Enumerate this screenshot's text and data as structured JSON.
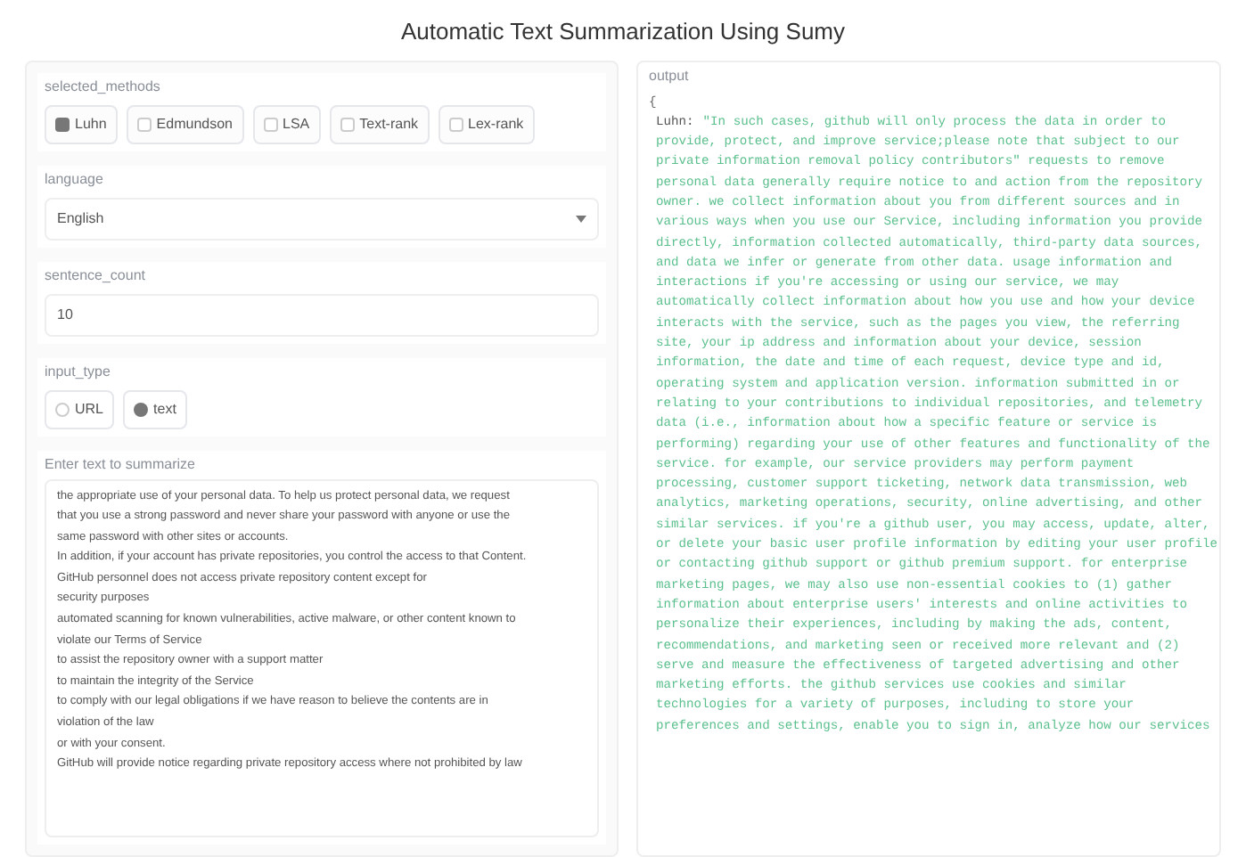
{
  "title": "Automatic Text Summarization Using Sumy",
  "methods": {
    "label": "selected_methods",
    "options": [
      {
        "label": "Luhn",
        "checked": true
      },
      {
        "label": "Edmundson",
        "checked": false
      },
      {
        "label": "LSA",
        "checked": false
      },
      {
        "label": "Text-rank",
        "checked": false
      },
      {
        "label": "Lex-rank",
        "checked": false
      }
    ]
  },
  "language": {
    "label": "language",
    "value": "English"
  },
  "sentence_count": {
    "label": "sentence_count",
    "value": "10"
  },
  "input_type": {
    "label": "input_type",
    "options": [
      {
        "label": "URL",
        "selected": false
      },
      {
        "label": "text",
        "selected": true
      }
    ]
  },
  "input_text": {
    "label": "Enter text to summarize",
    "lines": [
      "the appropriate use of your personal data. To help us protect personal data, we request",
      "that you use a strong password and never share your password with anyone or use the",
      "same password with other sites or accounts.",
      "In addition, if your account has private repositories, you control the access to that Content.",
      "GitHub personnel does not access private repository content except for",
      "security purposes",
      "automated scanning for known vulnerabilities, active malware, or other content known to",
      "violate our Terms of Service",
      "to assist the repository owner with a support matter",
      "to maintain the integrity of the Service",
      "to comply with our legal obligations if we have reason to believe the contents are in",
      "violation of the law",
      "or with your consent.",
      "GitHub will provide notice regarding private repository access where not prohibited by law"
    ]
  },
  "output": {
    "label": "output",
    "open_brace": "{",
    "key": "Luhn:",
    "lines": [
      "\"In such cases, github will only process the data in order to",
      "provide, protect, and improve service;please note that subject to our",
      "private information removal policy contributors\" requests to remove",
      "personal data generally require notice to and action from the repository",
      "owner. we collect information about you from different sources and in",
      "various ways when you use our Service, including information you provide",
      "directly, information collected automatically, third-party data sources,",
      "and data we infer or generate from other data. usage information and",
      "interactions if you're accessing or using our service, we may",
      "automatically collect information about how you use and how your device",
      "interacts with the service, such as the pages you view, the referring",
      "site, your ip address and information about your device, session",
      "information, the date and time of each request, device type and id,",
      "operating system and application version. information submitted in or",
      "relating to your contributions to individual repositories, and telemetry",
      "data (i.e., information about how a specific feature or service is",
      "performing) regarding your use of other features and functionality of the",
      "service. for example, our service providers may perform payment",
      "processing, customer support ticketing, network data transmission, web",
      "analytics, marketing operations, security, online advertising, and other",
      "similar services. if you're a github user, you may access, update, alter,",
      "or delete your basic user profile information by editing your user profile",
      "or contacting github support or github premium support. for enterprise",
      "marketing pages, we may also use non-essential cookies to (1) gather",
      "information about enterprise users' interests and online activities to",
      "personalize their experiences, including by making the ads, content,",
      "recommendations, and marketing seen or received more relevant and (2)",
      "serve and measure the effectiveness of targeted advertising and other",
      "marketing efforts. the github services use cookies and similar",
      "technologies for a variety of purposes, including to store your",
      "preferences and settings, enable you to sign in, analyze how our services"
    ]
  }
}
